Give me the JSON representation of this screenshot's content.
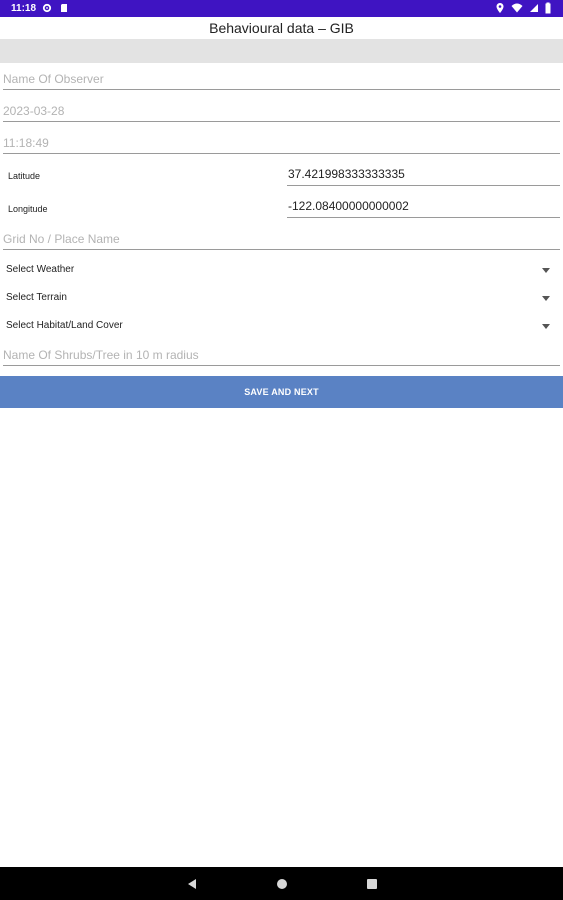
{
  "status_bar": {
    "time": "11:18",
    "background": "#3f14c2",
    "left_icons": [
      "gear-icon",
      "sd-card-icon"
    ],
    "right_icons": [
      "location-icon",
      "wifi-icon",
      "cell-signal-icon",
      "battery-icon"
    ]
  },
  "header": {
    "title": "Behavioural data – GIB"
  },
  "form": {
    "observer_name": {
      "value": "",
      "placeholder": "Name Of Observer"
    },
    "date": {
      "value": "",
      "placeholder": "2023-03-28"
    },
    "time": {
      "value": "",
      "placeholder": "11:18:49"
    },
    "latitude": {
      "label": "Latitude",
      "value": "37.421998333333335"
    },
    "longitude": {
      "label": "Longitude",
      "value": "-122.08400000000002"
    },
    "grid_place": {
      "value": "",
      "placeholder": "Grid No / Place Name"
    },
    "weather": {
      "selected": "Select Weather"
    },
    "terrain": {
      "selected": "Select Terrain"
    },
    "habitat": {
      "selected": "Select Habitat/Land Cover"
    },
    "shrubs_tree": {
      "value": "",
      "placeholder": "Name Of Shrubs/Tree in 10 m radius"
    },
    "save_label": "SAVE AND NEXT"
  },
  "colors": {
    "accent": "#5a82c4",
    "divider": "#9a9a9a",
    "strip": "#e3e3e3"
  },
  "nav_bar": {
    "buttons": [
      "back-icon",
      "home-icon",
      "recents-icon"
    ]
  }
}
